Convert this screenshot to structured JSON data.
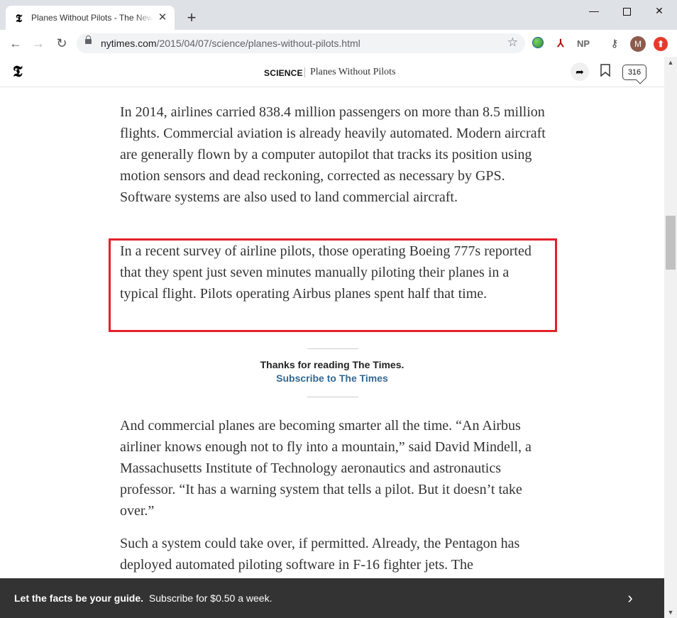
{
  "browser": {
    "tab_title": "Planes Without Pilots - The New York Times",
    "tab_favicon": "𝕿",
    "new_tab": "+",
    "url_host": "nytimes.com",
    "url_path": "/2015/04/07/science/planes-without-pilots.html",
    "extensions": {
      "pdf": "⅄",
      "np": "NP",
      "key": "⚷"
    },
    "avatar_initial": "M",
    "update_symbol": "⬆"
  },
  "header": {
    "logo": "𝕿",
    "section": "SCIENCE",
    "article_title": "Planes Without Pilots",
    "comment_count": "316"
  },
  "article": {
    "paragraphs": [
      "In 2014, airlines carried 838.4 million passengers on more than 8.5 million flights. Commercial aviation is already heavily automated. Modern aircraft are generally flown by a computer autopilot that tracks its position using motion sensors and dead reckoning, corrected as necessary by GPS. Software systems are also used to land commercial aircraft.",
      "In a recent survey of airline pilots, those operating Boeing 777s reported that they spent just seven minutes manually piloting their planes in a typical flight. Pilots operating Airbus planes spent half that time.",
      "And commercial planes are becoming smarter all the time. “An Airbus airliner knows enough not to fly into a mountain,” said David Mindell, a Massachusetts Institute of Technology aeronautics and astronautics professor. “It has a warning system that tells a pilot. But it doesn’t take over.”",
      "Such a system could take over, if permitted. Already, the Pentagon has deployed automated piloting software in F-16 fighter jets. The"
    ]
  },
  "promo": {
    "thanks": "Thanks for reading The Times.",
    "subscribe_link": "Subscribe to The Times"
  },
  "banner": {
    "bold": "Let the facts be your guide.",
    "text": "Subscribe for $0.50 a week."
  },
  "colors": {
    "highlight_border": "#e3202a",
    "link": "#326891",
    "banner_bg": "#333333"
  }
}
